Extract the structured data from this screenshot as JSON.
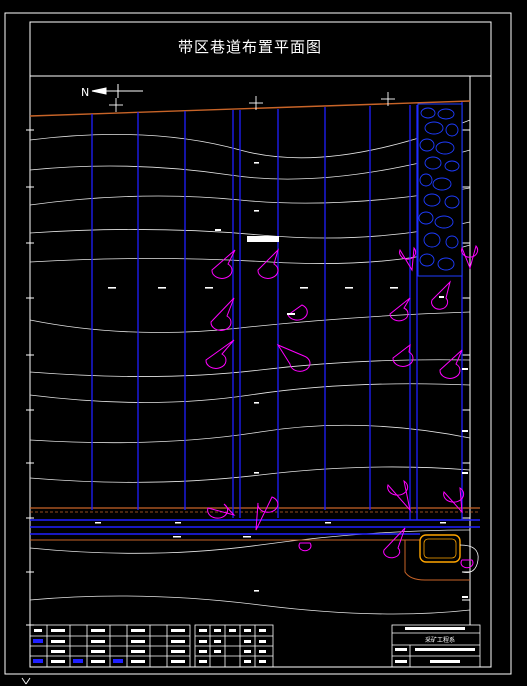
{
  "drawing": {
    "title": "带区巷道布置平面图",
    "north_label": "N",
    "titleblock_caption": "采矿工程系",
    "colors": {
      "background": "#000000",
      "frame": "#ffffff",
      "roadway": "#2020ff",
      "contour": "#ffffff",
      "boundary": "#c86428",
      "annotation": "#ff00ff",
      "goaf": "#1e3cff",
      "chamber": "#ffa500"
    },
    "icons": [
      "north-arrow-icon",
      "crosshair-icon",
      "goaf-hatch-icon",
      "label-bubble-icon"
    ]
  }
}
